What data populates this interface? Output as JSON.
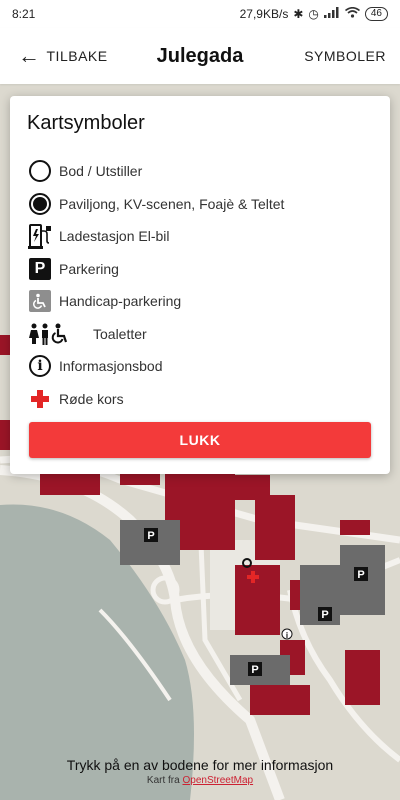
{
  "status_bar": {
    "time": "8:21",
    "net_speed": "27,9KB/s",
    "battery": "46"
  },
  "app_bar": {
    "back_label": "TILBAKE",
    "title": "Julegada",
    "symbols_label": "SYMBOLER"
  },
  "dialog": {
    "title": "Kartsymboler",
    "items": [
      {
        "icon": "open-circle-icon",
        "label": "Bod / Utstiller"
      },
      {
        "icon": "filled-circle-icon",
        "label": "Paviljong, KV-scenen, Foajè & Teltet"
      },
      {
        "icon": "ev-charger-icon",
        "label": "Ladestasjon El-bil"
      },
      {
        "icon": "parking-icon",
        "label": "Parkering"
      },
      {
        "icon": "handicap-parking-icon",
        "label": "Handicap-parkering"
      },
      {
        "icon": "toilet-icon",
        "label": "Toaletter"
      },
      {
        "icon": "info-icon",
        "label": "Informasjonsbod"
      },
      {
        "icon": "red-cross-icon",
        "label": "Røde kors"
      }
    ],
    "close_label": "LUKK"
  },
  "map": {
    "parking_symbol": "P",
    "info_symbol": "i"
  },
  "footer": {
    "hint": "Trykk på en av bodene for mer informasjon",
    "credit_prefix": "Kart fra",
    "credit_link": "OpenStreetMap"
  },
  "colors": {
    "accent": "#f33a3a",
    "building": "#9b1527",
    "parking": "#6b6b6b",
    "water": "#a9b3ad",
    "land": "#dcd9cf"
  }
}
